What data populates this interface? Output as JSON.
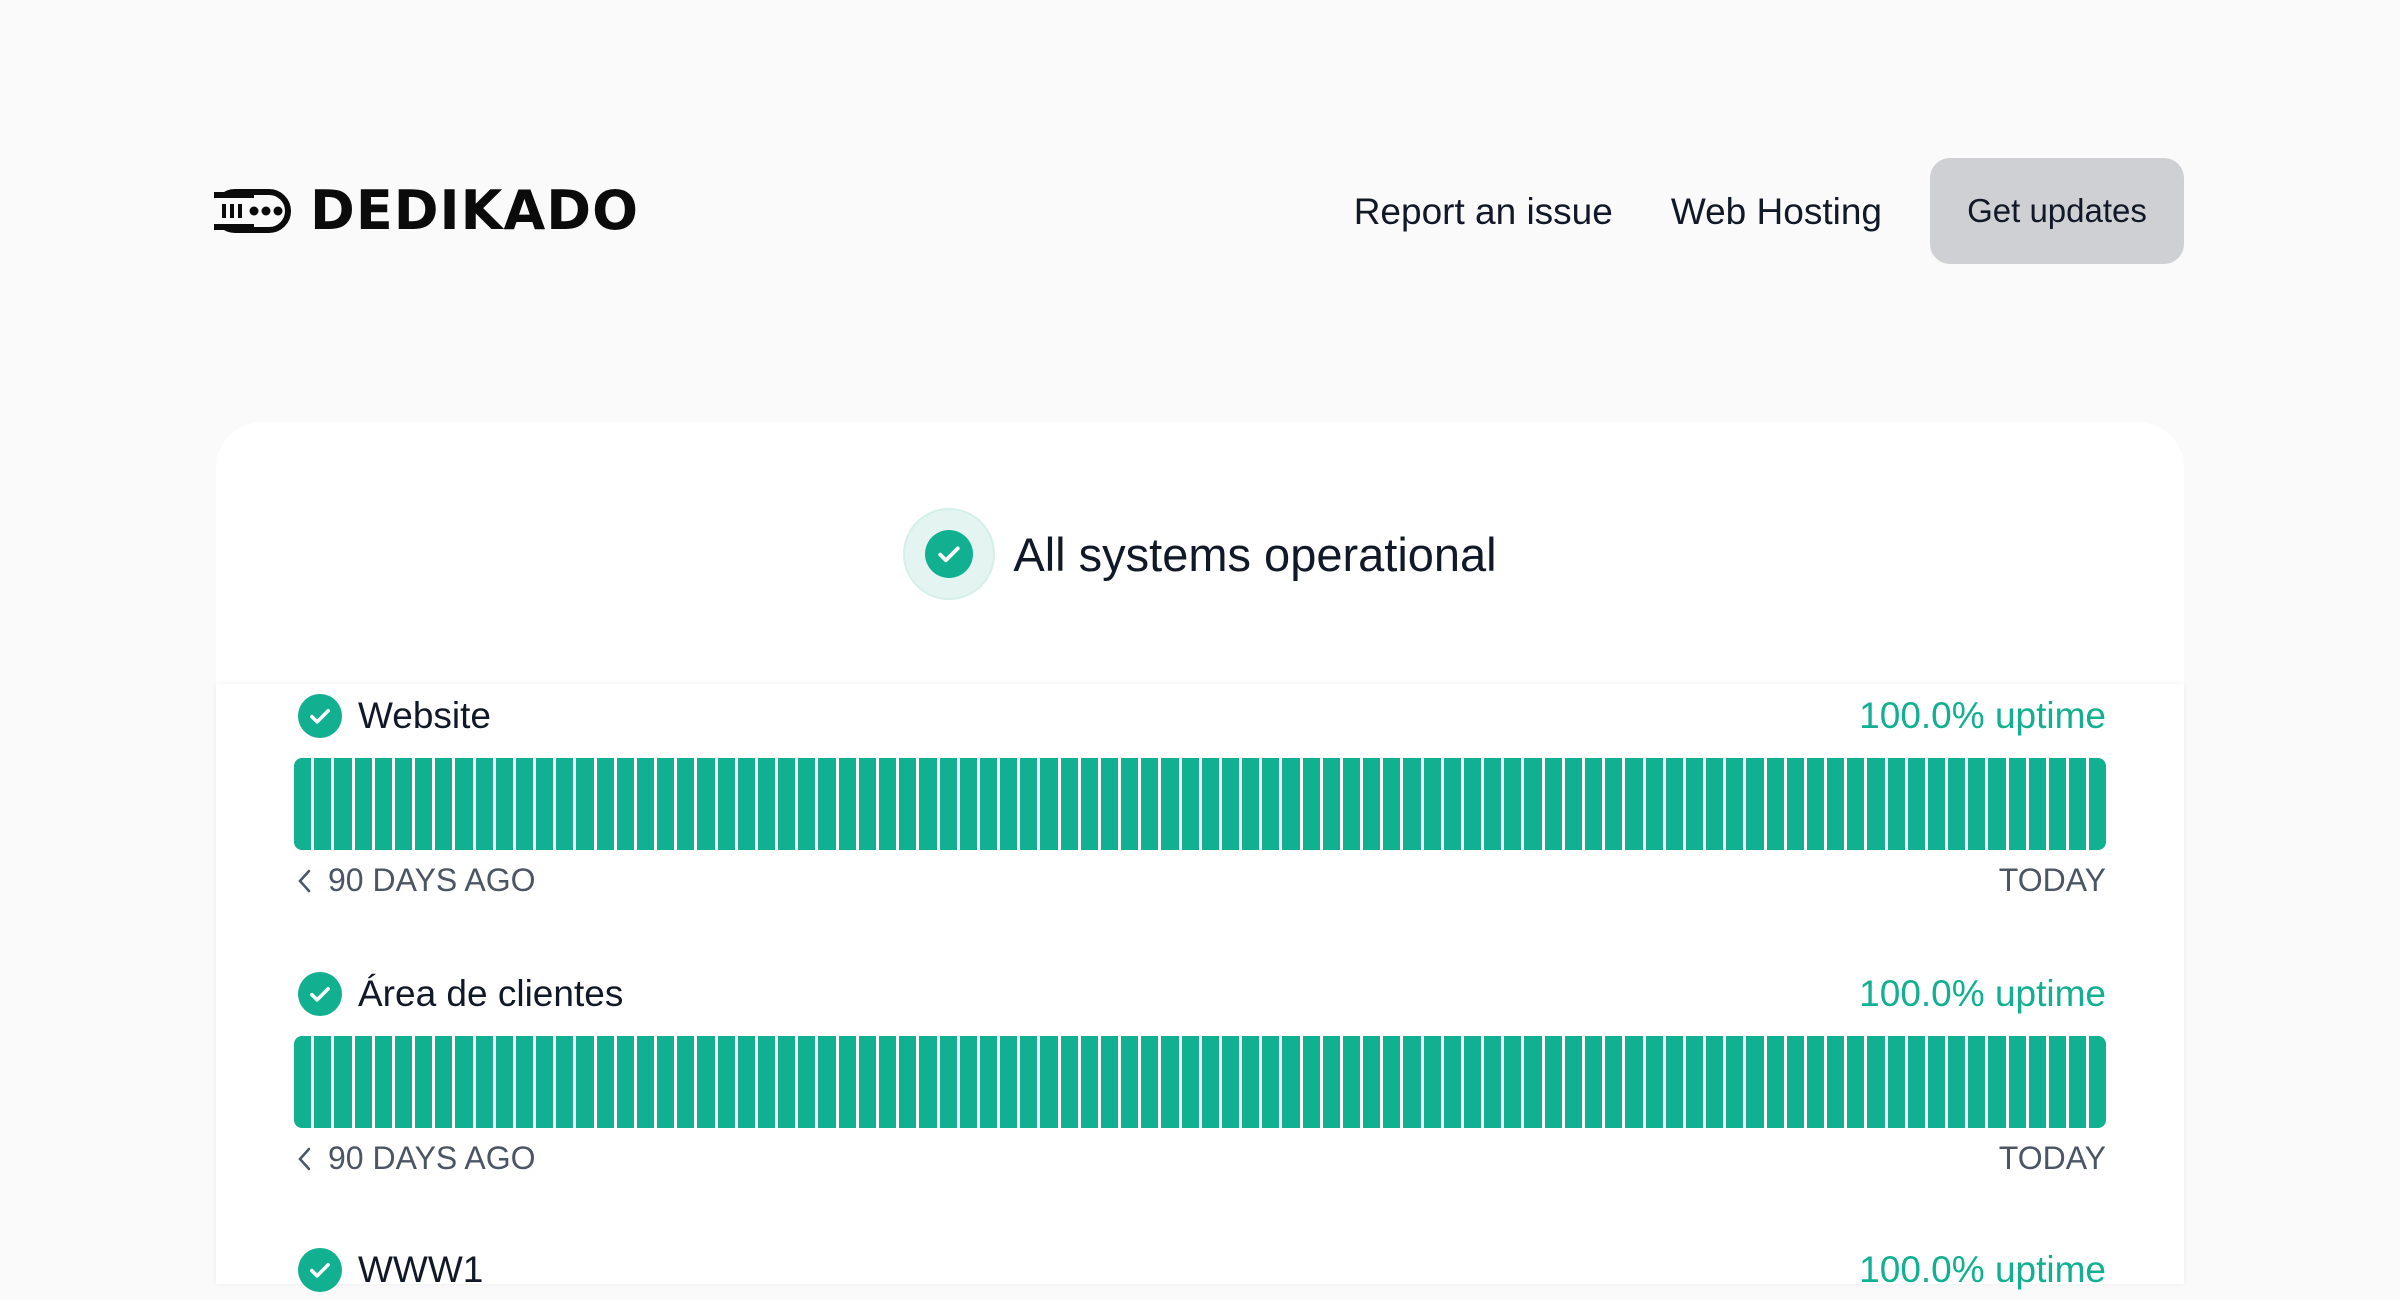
{
  "header": {
    "brand": "DEDIKADO",
    "nav": [
      "Report an issue",
      "Web Hosting"
    ],
    "cta_label": "Get updates"
  },
  "status": {
    "title": "All systems operational"
  },
  "components": [
    {
      "name": "Website",
      "uptime": "100.0% uptime",
      "range_start": "90 DAYS AGO",
      "range_end": "TODAY",
      "days": 90,
      "status": "operational"
    },
    {
      "name": "Área de clientes",
      "uptime": "100.0% uptime",
      "range_start": "90 DAYS AGO",
      "range_end": "TODAY",
      "days": 90,
      "status": "operational"
    },
    {
      "name": "WWW1",
      "uptime": "100.0% uptime"
    }
  ],
  "colors": {
    "operational": "#10b090",
    "cta_bg": "#cfd0d3",
    "page_bg": "#fafafa"
  }
}
